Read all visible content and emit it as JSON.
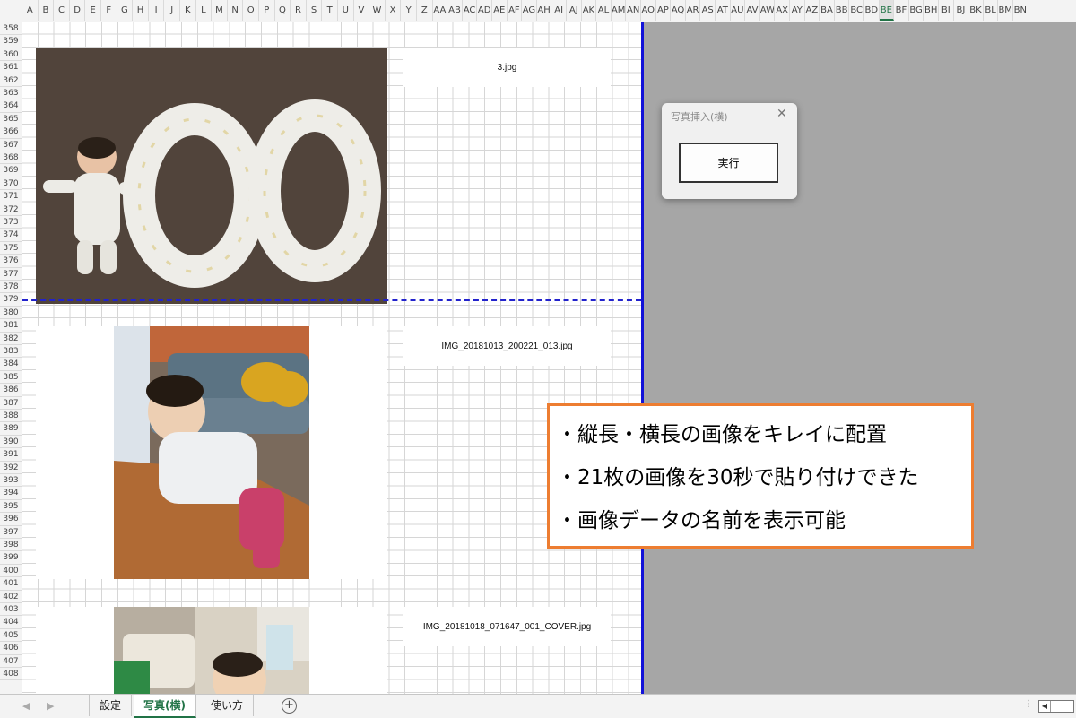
{
  "colors": {
    "accent": "#217346",
    "callout_border": "#ed7d31",
    "print_line": "#1212d8",
    "outside_area": "#a6a6a6"
  },
  "column_headers": [
    "A",
    "B",
    "C",
    "D",
    "E",
    "F",
    "G",
    "H",
    "I",
    "J",
    "K",
    "L",
    "M",
    "N",
    "O",
    "P",
    "Q",
    "R",
    "S",
    "T",
    "U",
    "V",
    "W",
    "X",
    "Y",
    "Z",
    "AA",
    "AB",
    "AC",
    "AD",
    "AE",
    "AF",
    "AG",
    "AH",
    "AI",
    "AJ",
    "AK",
    "AL",
    "AM",
    "AN",
    "AO",
    "AP",
    "AQ",
    "AR",
    "AS",
    "AT",
    "AU",
    "AV",
    "AW",
    "AX",
    "AY",
    "AZ",
    "BA",
    "BB",
    "BC",
    "BD",
    "BE",
    "BF",
    "BG",
    "BH",
    "BI",
    "BJ",
    "BK",
    "BL",
    "BM",
    "BN"
  ],
  "active_column": "BE",
  "row_headers": [
    "358",
    "359",
    "360",
    "361",
    "362",
    "363",
    "364",
    "365",
    "366",
    "367",
    "368",
    "369",
    "370",
    "371",
    "372",
    "373",
    "374",
    "375",
    "376",
    "377",
    "378",
    "379",
    "380",
    "381",
    "382",
    "383",
    "384",
    "385",
    "386",
    "387",
    "388",
    "389",
    "390",
    "391",
    "392",
    "393",
    "394",
    "395",
    "396",
    "397",
    "398",
    "399",
    "400",
    "401",
    "402",
    "403",
    "404",
    "405",
    "406",
    "407",
    "408"
  ],
  "photos": [
    {
      "filename": "3.jpg"
    },
    {
      "filename": "IMG_20181013_200221_013.jpg"
    },
    {
      "filename": "IMG_20181018_071647_001_COVER.jpg"
    }
  ],
  "dialog": {
    "title": "写真挿入(横)",
    "close_icon": "close-icon",
    "run_label": "実行"
  },
  "callout": {
    "lines": [
      "・縦長・横長の画像をキレイに配置",
      "・21枚の画像を30秒で貼り付けできた",
      "・画像データの名前を表示可能"
    ]
  },
  "sheet_tabs": [
    {
      "label": "設定",
      "active": false
    },
    {
      "label": "写真(横)",
      "active": true
    },
    {
      "label": "使い方",
      "active": false
    }
  ],
  "add_sheet_label": "+"
}
